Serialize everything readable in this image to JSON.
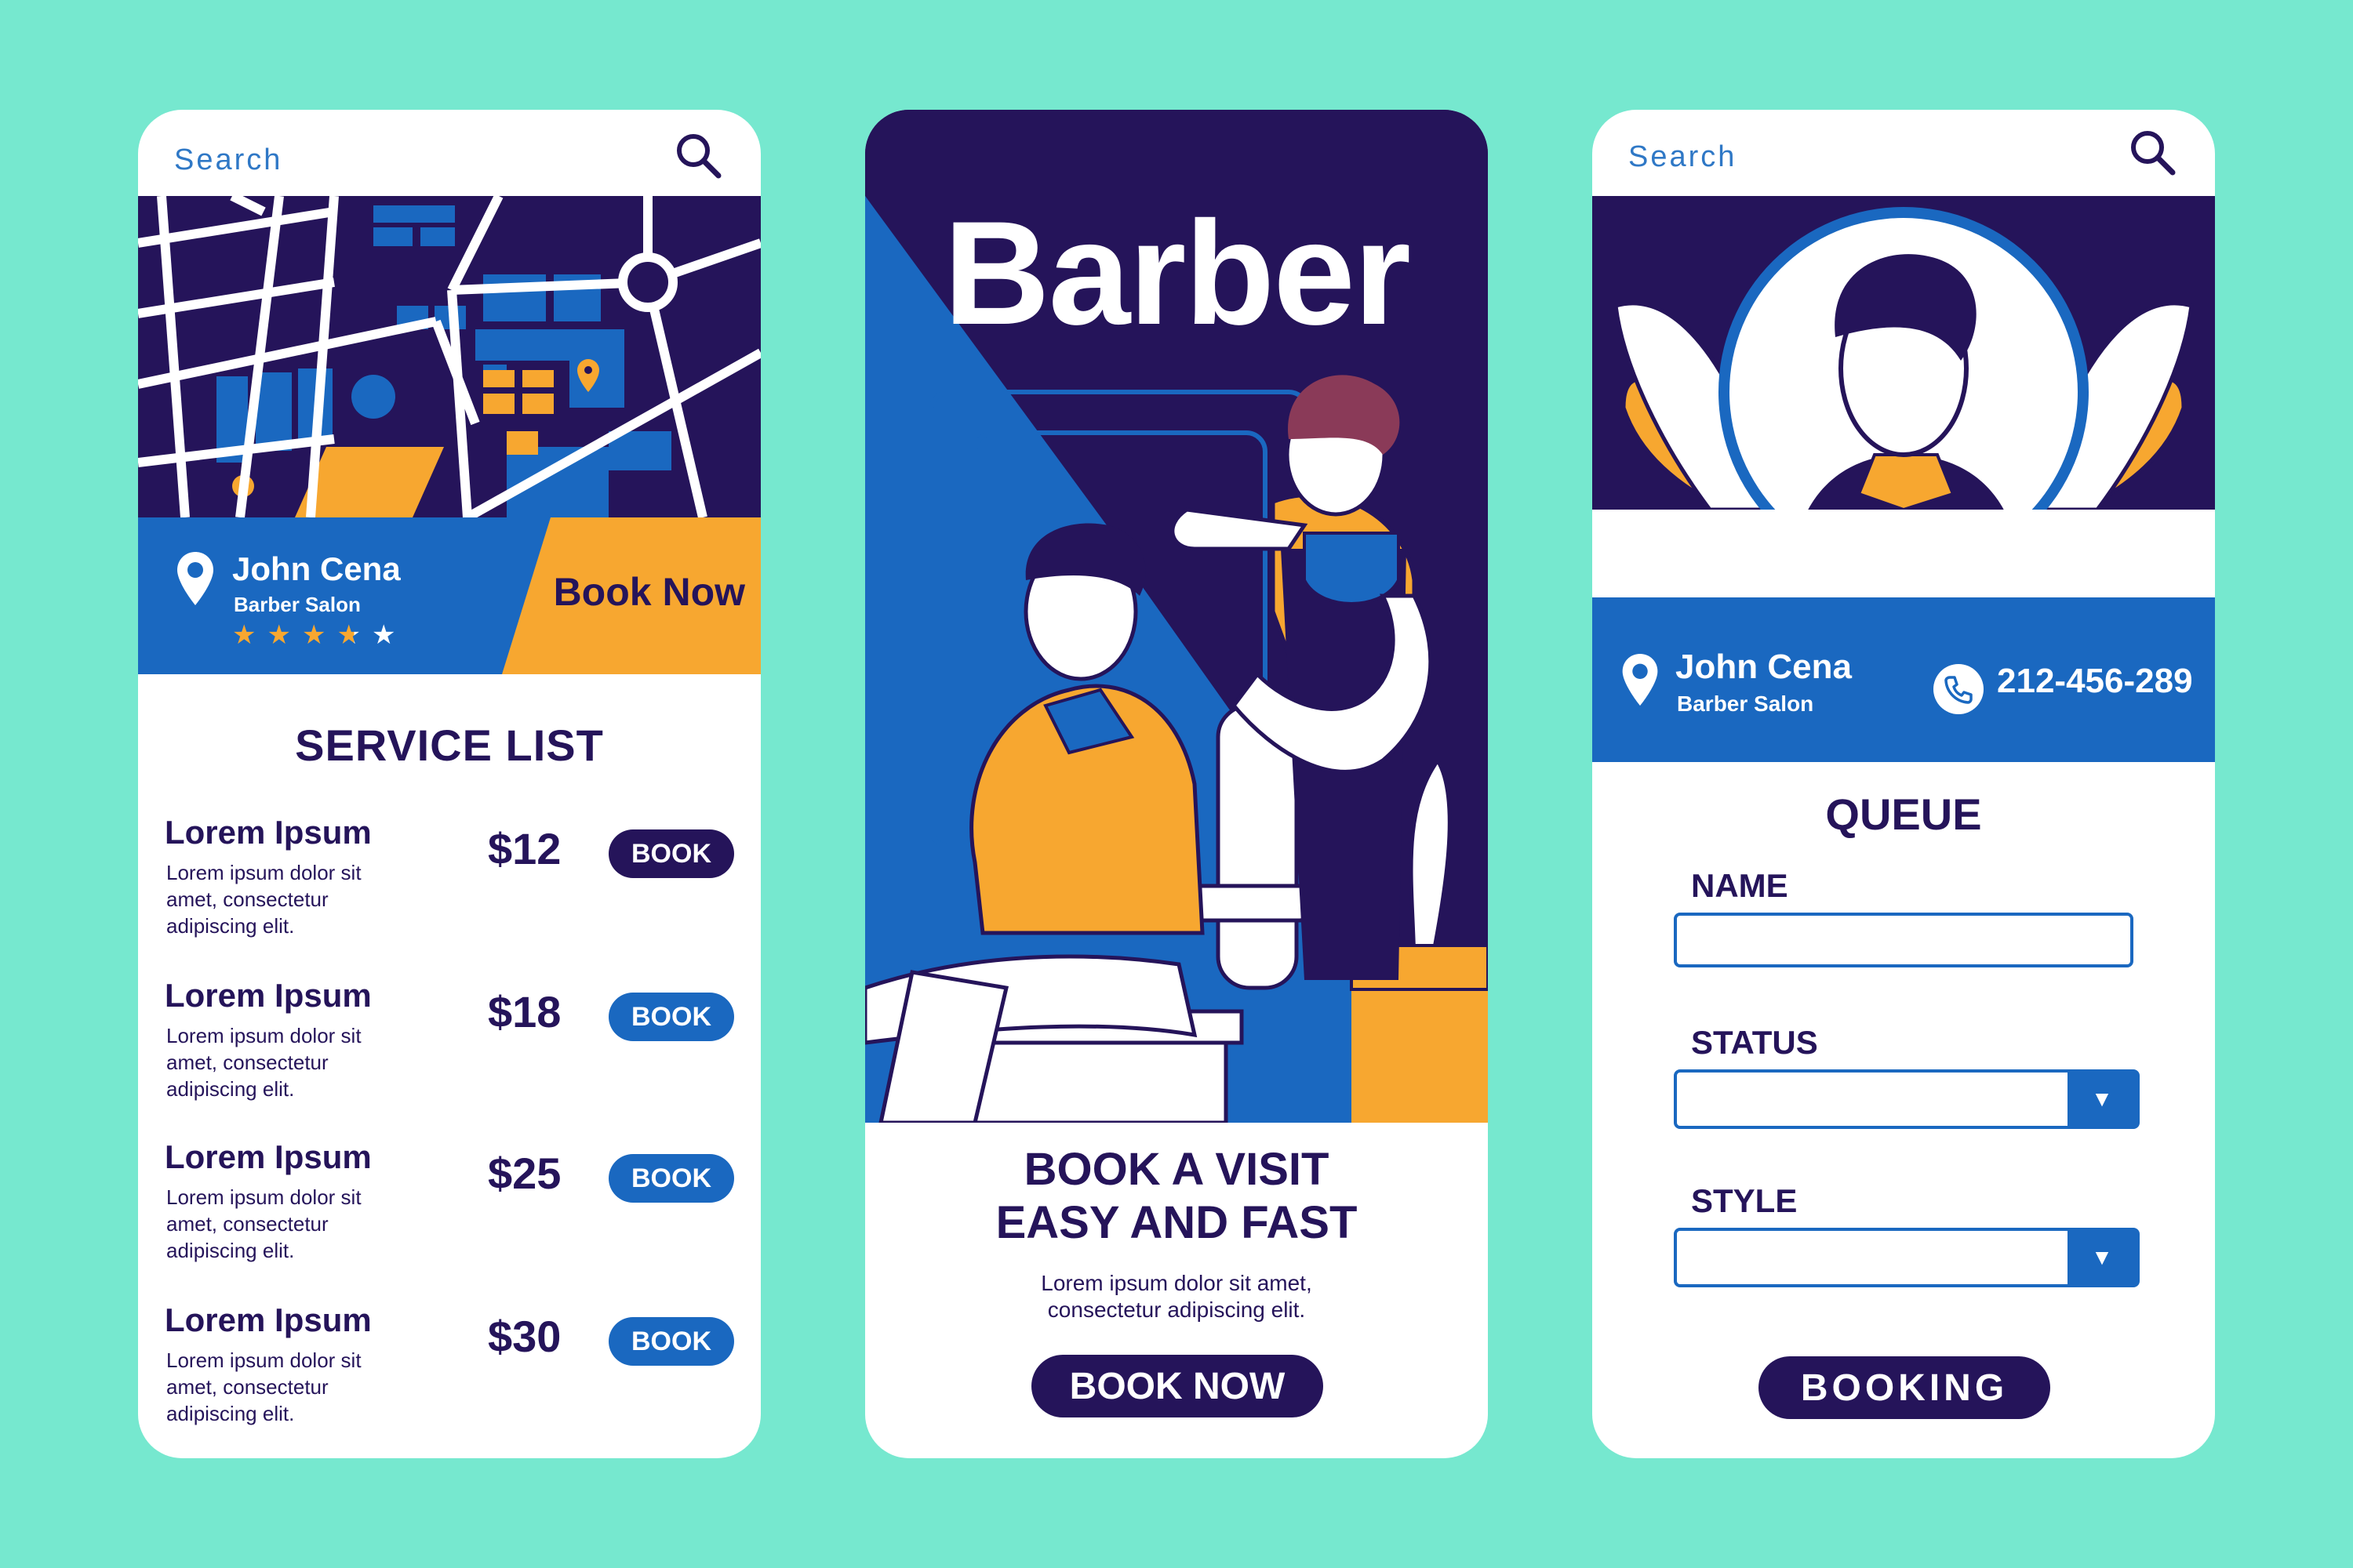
{
  "colors": {
    "background": "#76e8cf",
    "navy": "#25145a",
    "blue": "#1a68c0",
    "orange": "#f7a730",
    "white": "#ffffff"
  },
  "screen1": {
    "search": {
      "placeholder": "Search",
      "icon": "search-icon"
    },
    "location": {
      "name": "John Cena",
      "type": "Barber Salon",
      "rating": 3.5,
      "rating_max": 5,
      "book_label": "Book Now"
    },
    "service_list": {
      "title": "SERVICE LIST",
      "items": [
        {
          "name": "Lorem Ipsum",
          "description": "Lorem ipsum dolor sit amet, consectetur adipiscing elit.",
          "price": "$12",
          "button": "BOOK"
        },
        {
          "name": "Lorem Ipsum",
          "description": "Lorem ipsum dolor sit amet, consectetur adipiscing elit.",
          "price": "$18",
          "button": "BOOK"
        },
        {
          "name": "Lorem Ipsum",
          "description": "Lorem ipsum dolor sit amet, consectetur adipiscing elit.",
          "price": "$25",
          "button": "BOOK"
        },
        {
          "name": "Lorem Ipsum",
          "description": "Lorem ipsum dolor sit amet, consectetur adipiscing elit.",
          "price": "$30",
          "button": "BOOK"
        }
      ]
    }
  },
  "screen2": {
    "hero_title": "Barber",
    "headline_line1": "BOOK A VISIT",
    "headline_line2": "EASY AND FAST",
    "sub_text": "Lorem ipsum dolor sit amet, consectetur adipiscing elit.",
    "button": "BOOK NOW"
  },
  "screen3": {
    "search": {
      "placeholder": "Search",
      "icon": "search-icon"
    },
    "profile": {
      "name": "John Cena",
      "type": "Barber Salon",
      "phone": "212-456-289"
    },
    "queue": {
      "title": "QUEUE",
      "name_label": "NAME",
      "name_value": "",
      "status_label": "STATUS",
      "status_value": "",
      "style_label": "STYLE",
      "style_value": ""
    },
    "button": "BOOKING"
  }
}
